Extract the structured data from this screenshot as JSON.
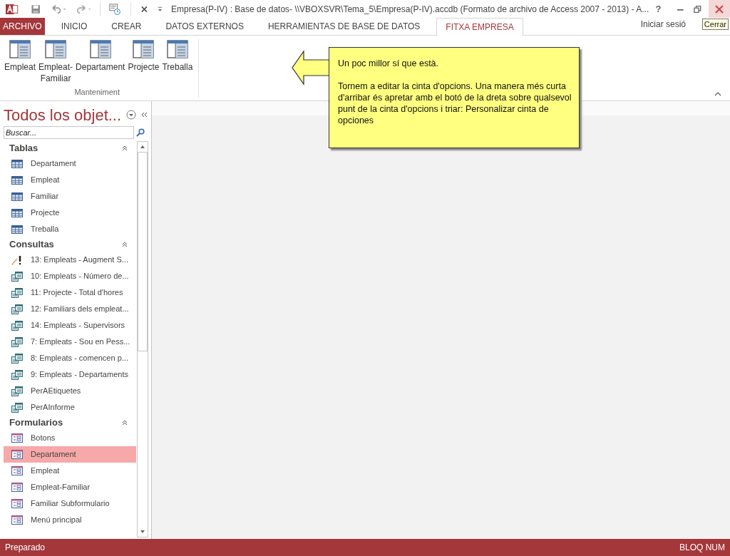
{
  "window": {
    "title": "Empresa(P-IV) : Base de datos- \\\\VBOXSVR\\Tema_5\\Empresa(P-IV).accdb (Formato de archivo de Access 2007 - 2013) - A...",
    "help": "?",
    "tooltip": "Cerrar"
  },
  "tabs": [
    {
      "label": "ARCHIVO",
      "kind": "file",
      "selected": false
    },
    {
      "label": "INICIO",
      "kind": "tab",
      "selected": false
    },
    {
      "label": "CREAR",
      "kind": "tab",
      "selected": false
    },
    {
      "label": "DATOS EXTERNOS",
      "kind": "tab",
      "selected": false
    },
    {
      "label": "HERRAMIENTAS DE BASE DE DATOS",
      "kind": "tab",
      "selected": false
    },
    {
      "label": "FITXA EMPRESA",
      "kind": "tab",
      "selected": true
    }
  ],
  "sign_in": "Iniciar sesió",
  "ribbon": {
    "group": "Manteniment",
    "buttons": [
      "Empleat",
      "Empleat-\nFamiliar",
      "Departament",
      "Projecte",
      "Treballa"
    ]
  },
  "callout": {
    "lines": [
      "Un poc millor sí que està.",
      "Tornem a editar la cinta d'opcions. Una manera més curta d'arribar és apretar amb el botó de la dreta sobre qualsevol punt de la cinta d'opcions i triar: Personalizar cinta de opciones"
    ]
  },
  "nav": {
    "title": "Todos los objet...",
    "search": {
      "placeholder": "Buscar..."
    },
    "groups": [
      {
        "label": "Tablas",
        "items": [
          {
            "label": "Departament",
            "kind": "table",
            "selected": false
          },
          {
            "label": "Empleat",
            "kind": "table",
            "selected": false
          },
          {
            "label": "Familiar",
            "kind": "table",
            "selected": false
          },
          {
            "label": "Projecte",
            "kind": "table",
            "selected": false
          },
          {
            "label": "Treballa",
            "kind": "table",
            "selected": false
          }
        ]
      },
      {
        "label": "Consultas",
        "items": [
          {
            "label": "13: Empleats - Augment S...",
            "kind": "action",
            "selected": false
          },
          {
            "label": "10: Empleats - Número de...",
            "kind": "query",
            "selected": false
          },
          {
            "label": "11: Projecte - Total d'hores",
            "kind": "query",
            "selected": false
          },
          {
            "label": "12: Familiars dels empleat...",
            "kind": "query",
            "selected": false
          },
          {
            "label": "14: Empleats - Supervisors",
            "kind": "query",
            "selected": false
          },
          {
            "label": "7: Empleats - Sou en Pess...",
            "kind": "query",
            "selected": false
          },
          {
            "label": "8: Empleats - comencen p...",
            "kind": "query",
            "selected": false
          },
          {
            "label": "9: Empleats - Departaments",
            "kind": "query",
            "selected": false
          },
          {
            "label": "PerAEtiquetes",
            "kind": "query",
            "selected": false
          },
          {
            "label": "PerAInforme",
            "kind": "query",
            "selected": false
          }
        ]
      },
      {
        "label": "Formularios",
        "items": [
          {
            "label": "Botons",
            "kind": "form",
            "selected": false
          },
          {
            "label": "Departament",
            "kind": "form",
            "selected": true
          },
          {
            "label": "Empleat",
            "kind": "form",
            "selected": false
          },
          {
            "label": "Empleat-Familiar",
            "kind": "form",
            "selected": false
          },
          {
            "label": "Familiar Subformulario",
            "kind": "form",
            "selected": false
          },
          {
            "label": "Menú principal",
            "kind": "form",
            "selected": false
          }
        ]
      }
    ]
  },
  "status_bar": {
    "left": "Preparado",
    "right": "BLOQ NUM"
  }
}
